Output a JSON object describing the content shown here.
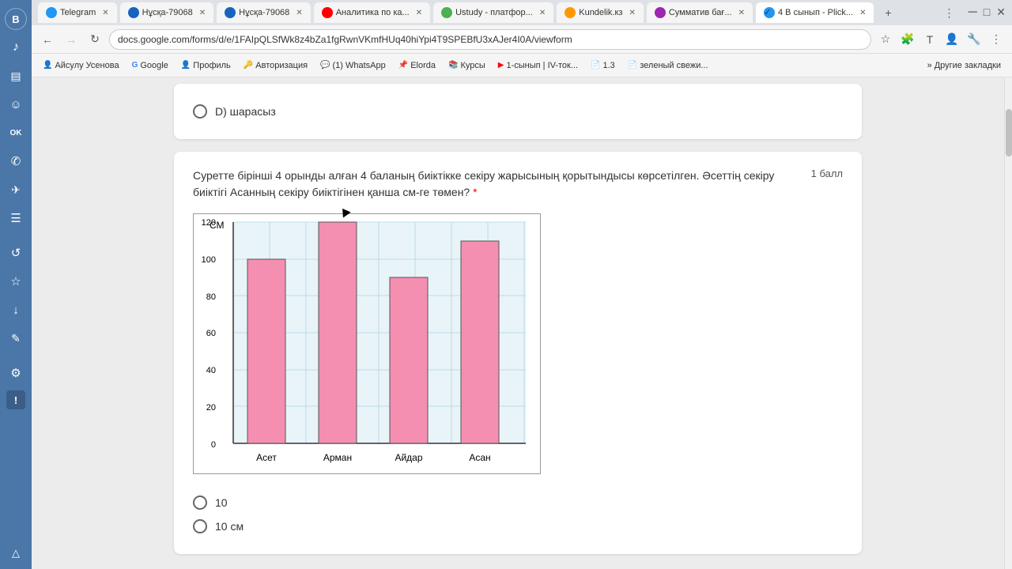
{
  "browser": {
    "tabs": [
      {
        "id": "telegram",
        "label": "Telegram",
        "active": false,
        "icon_color": "#2196f3"
      },
      {
        "id": "nuska1",
        "label": "Нұсқа-79068",
        "active": false,
        "icon_color": "#1565c0"
      },
      {
        "id": "nuska2",
        "label": "Нұсқа-79068",
        "active": false,
        "icon_color": "#1565c0"
      },
      {
        "id": "analytics",
        "label": "Аналитика по ка...",
        "active": false,
        "icon_color": "#ff0000"
      },
      {
        "id": "ustudy",
        "label": "Ustudy - платфор...",
        "active": false,
        "icon_color": "#4caf50"
      },
      {
        "id": "kundelik",
        "label": "Kundelik.кз",
        "active": false,
        "icon_color": "#ff9800"
      },
      {
        "id": "summative",
        "label": "Сумматив бағ...",
        "active": false,
        "icon_color": "#9c27b0"
      },
      {
        "id": "4b",
        "label": "4 В сынып - Plick...",
        "active": true,
        "icon_color": "#2196f3"
      }
    ],
    "address": "docs.google.com/forms/d/e/1FAIpQLSfWk8z4bZa1fgRwnVKmfHUq40hiYpi4T9SPEBfU3xAJer4I0A/viewform",
    "bookmarks": [
      {
        "label": "Айсулу Усенова",
        "icon": "👤"
      },
      {
        "label": "Google",
        "icon": "G"
      },
      {
        "label": "Профиль",
        "icon": "👤"
      },
      {
        "label": "Авторизация",
        "icon": "🔑"
      },
      {
        "label": "(1) WhatsApp",
        "icon": "💬"
      },
      {
        "label": "Elorda",
        "icon": "📌"
      },
      {
        "label": "Курсы",
        "icon": "📚"
      },
      {
        "label": "1-сынып | IV-ток...",
        "icon": "▶"
      },
      {
        "label": "1.3",
        "icon": "📄"
      },
      {
        "label": "зеленый свежи...",
        "icon": "📄"
      }
    ],
    "other_bookmarks": "Другие закладки"
  },
  "form": {
    "prev_option_label": "D) шарасыз",
    "question_text": "Суретте бірінші 4 орынды алған 4 баланың биіктікке секіру жарысының қорытындысы көрсетілген. Әсеттің секіру биіктігі Асанның секіру биіктігінен қанша см-ге төмен?",
    "required_marker": "*",
    "points_label": "1 балл",
    "chart": {
      "y_label": "СМ",
      "y_axis": [
        0,
        20,
        40,
        60,
        80,
        100,
        120
      ],
      "bars": [
        {
          "name": "Асет",
          "value": 100
        },
        {
          "name": "Арман",
          "value": 120
        },
        {
          "name": "Айдар",
          "value": 90
        },
        {
          "name": "Асан",
          "value": 110
        }
      ],
      "bar_color": "#f48fb1",
      "bar_border": "#333",
      "max_value": 120
    },
    "answer_options": [
      {
        "id": "opt1",
        "label": "10"
      },
      {
        "id": "opt2",
        "label": "10 см"
      }
    ]
  },
  "sidebar_icons": [
    {
      "id": "vk",
      "symbol": "B",
      "title": "VK"
    },
    {
      "id": "music",
      "symbol": "♪",
      "title": "Music"
    },
    {
      "id": "chart",
      "symbol": "▤",
      "title": "Stats"
    },
    {
      "id": "face",
      "symbol": "☺",
      "title": "Face"
    },
    {
      "id": "ok",
      "symbol": "ok",
      "title": "OK"
    },
    {
      "id": "phone",
      "symbol": "✆",
      "title": "Phone"
    },
    {
      "id": "telegram",
      "symbol": "✈",
      "title": "Telegram"
    },
    {
      "id": "list",
      "symbol": "☰",
      "title": "List"
    },
    {
      "id": "history",
      "symbol": "↺",
      "title": "History"
    },
    {
      "id": "star",
      "symbol": "☆",
      "title": "Star"
    },
    {
      "id": "download",
      "symbol": "↓",
      "title": "Download"
    },
    {
      "id": "edit",
      "symbol": "✎",
      "title": "Edit"
    },
    {
      "id": "settings",
      "symbol": "⚙",
      "title": "Settings"
    },
    {
      "id": "exclaim",
      "symbol": "!",
      "title": "Alert"
    },
    {
      "id": "up",
      "symbol": "△",
      "title": "Up"
    }
  ]
}
